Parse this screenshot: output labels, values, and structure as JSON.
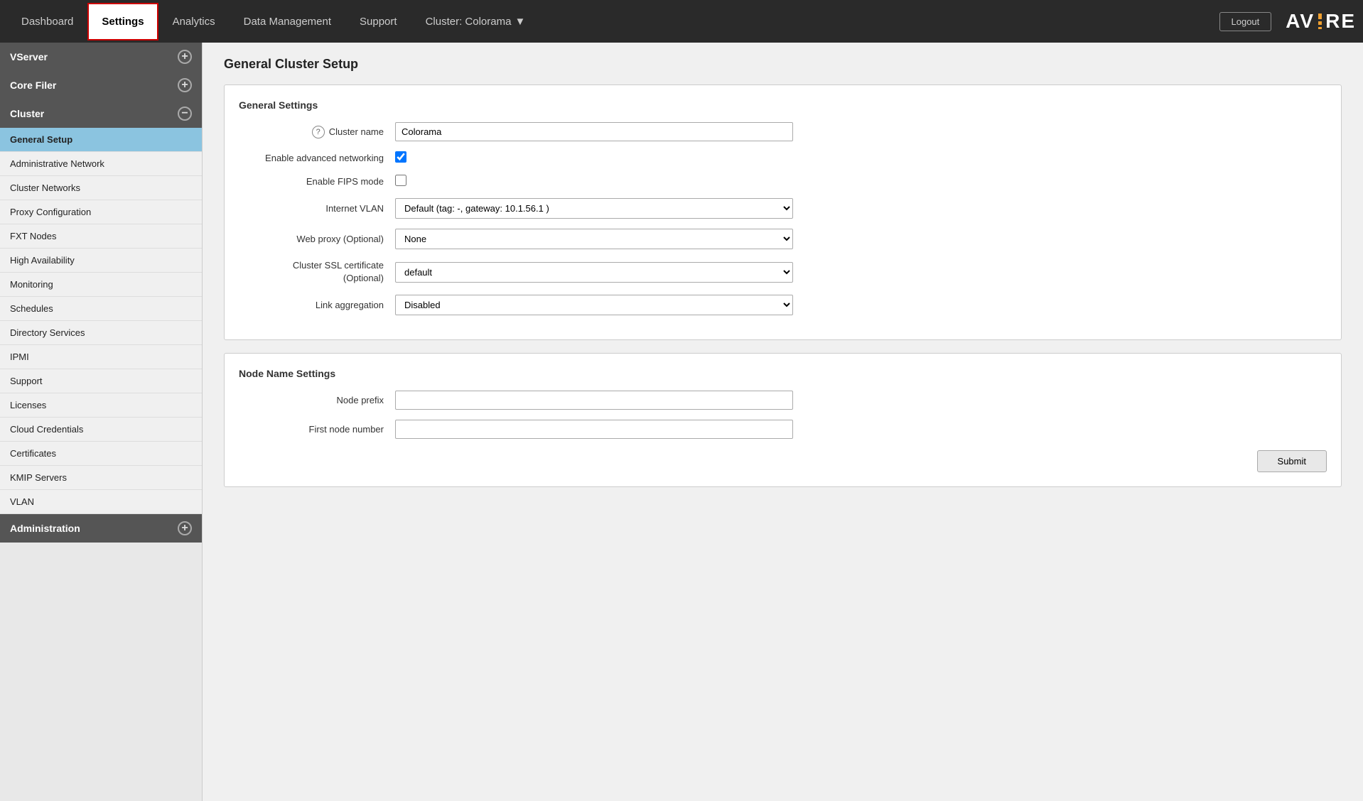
{
  "topbar": {
    "logout_label": "Logout",
    "nav_tabs": [
      {
        "id": "dashboard",
        "label": "Dashboard",
        "active": false
      },
      {
        "id": "settings",
        "label": "Settings",
        "active": true
      },
      {
        "id": "analytics",
        "label": "Analytics",
        "active": false
      },
      {
        "id": "data_management",
        "label": "Data Management",
        "active": false
      },
      {
        "id": "support",
        "label": "Support",
        "active": false
      }
    ],
    "cluster_selector": "Cluster: Colorama",
    "logo_text_left": "AV",
    "logo_text_right": "RE"
  },
  "sidebar": {
    "sections": [
      {
        "id": "vserver",
        "label": "VServer",
        "icon": "+",
        "expanded": false,
        "items": []
      },
      {
        "id": "core_filer",
        "label": "Core Filer",
        "icon": "+",
        "expanded": false,
        "items": []
      },
      {
        "id": "cluster",
        "label": "Cluster",
        "icon": "−",
        "expanded": true,
        "items": [
          {
            "id": "general_setup",
            "label": "General Setup",
            "active": true
          },
          {
            "id": "administrative_network",
            "label": "Administrative Network",
            "active": false
          },
          {
            "id": "cluster_networks",
            "label": "Cluster Networks",
            "active": false
          },
          {
            "id": "proxy_configuration",
            "label": "Proxy Configuration",
            "active": false
          },
          {
            "id": "fxt_nodes",
            "label": "FXT Nodes",
            "active": false
          },
          {
            "id": "high_availability",
            "label": "High Availability",
            "active": false
          },
          {
            "id": "monitoring",
            "label": "Monitoring",
            "active": false
          },
          {
            "id": "schedules",
            "label": "Schedules",
            "active": false
          },
          {
            "id": "directory_services",
            "label": "Directory Services",
            "active": false
          },
          {
            "id": "ipmi",
            "label": "IPMI",
            "active": false
          },
          {
            "id": "support",
            "label": "Support",
            "active": false
          },
          {
            "id": "licenses",
            "label": "Licenses",
            "active": false
          },
          {
            "id": "cloud_credentials",
            "label": "Cloud Credentials",
            "active": false
          },
          {
            "id": "certificates",
            "label": "Certificates",
            "active": false
          },
          {
            "id": "kmip_servers",
            "label": "KMIP Servers",
            "active": false
          },
          {
            "id": "vlan",
            "label": "VLAN",
            "active": false
          }
        ]
      },
      {
        "id": "administration",
        "label": "Administration",
        "icon": "+",
        "expanded": false,
        "items": []
      }
    ]
  },
  "content": {
    "page_title": "General Cluster Setup",
    "general_settings": {
      "section_label": "General Settings",
      "cluster_name_label": "Cluster name",
      "cluster_name_value": "Colorama",
      "enable_advanced_networking_label": "Enable advanced networking",
      "enable_advanced_networking_checked": true,
      "enable_fips_mode_label": "Enable FIPS mode",
      "enable_fips_mode_checked": false,
      "internet_vlan_label": "Internet VLAN",
      "internet_vlan_options": [
        "Default (tag: -, gateway: 10.1.56.1 )"
      ],
      "internet_vlan_value": "Default (tag: -, gateway: 10.1.56.1 )",
      "web_proxy_label": "Web proxy (Optional)",
      "web_proxy_options": [
        "None"
      ],
      "web_proxy_value": "None",
      "cluster_ssl_label": "Cluster SSL certificate (Optional)",
      "cluster_ssl_options": [
        "default"
      ],
      "cluster_ssl_value": "default",
      "link_aggregation_label": "Link aggregation",
      "link_aggregation_options": [
        "Disabled"
      ],
      "link_aggregation_value": "Disabled"
    },
    "node_name_settings": {
      "section_label": "Node Name Settings",
      "node_prefix_label": "Node prefix",
      "node_prefix_value": "",
      "first_node_number_label": "First node number",
      "first_node_number_value": ""
    },
    "submit_label": "Submit"
  }
}
